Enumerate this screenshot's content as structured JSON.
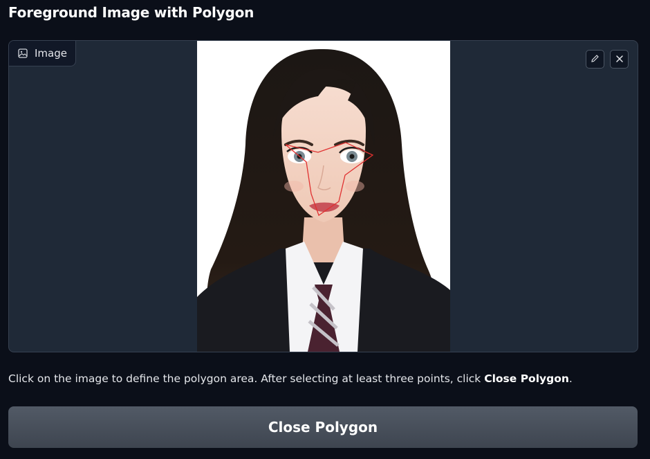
{
  "page": {
    "title": "Foreground Image with Polygon"
  },
  "image_block": {
    "label": "Image",
    "label_icon": "image-icon",
    "toolbar": {
      "edit_icon": "pencil-icon",
      "clear_icon": "close-icon"
    },
    "overlay_color": "#e03030"
  },
  "instructions": {
    "prefix": "Click on the image to define the polygon area. After selecting at least three points, click ",
    "emphasis": "Close Polygon",
    "suffix": "."
  },
  "close_button": {
    "label": "Close Polygon"
  },
  "colors": {
    "background": "#0b0f19",
    "panel": "#1f2937",
    "button": "#4b5360",
    "polygon": "#e03030"
  }
}
